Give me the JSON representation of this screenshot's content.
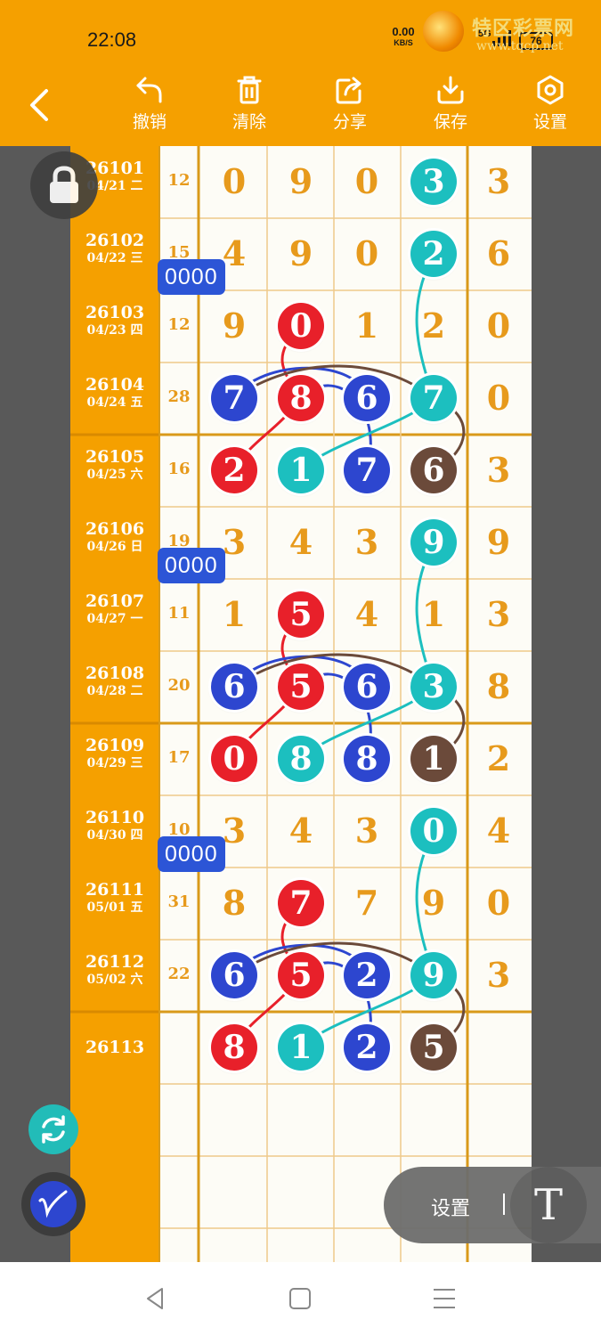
{
  "status_bar": {
    "time": "22:08",
    "net_speed": "0.00",
    "net_unit": "KB/S",
    "signal": "5G",
    "battery": "76"
  },
  "watermark": {
    "site_name": "特区彩票网",
    "url": "www.tqcp.net"
  },
  "toolbar": {
    "items": [
      {
        "label": "撤销",
        "icon": "undo-icon"
      },
      {
        "label": "清除",
        "icon": "trash-icon"
      },
      {
        "label": "分享",
        "icon": "share-icon"
      },
      {
        "label": "保存",
        "icon": "download-icon"
      },
      {
        "label": "设置",
        "icon": "gear-icon"
      }
    ]
  },
  "rows": [
    {
      "issue": "26101",
      "date": "04/21 二",
      "sum": "12",
      "digits": [
        "0",
        "9",
        "0",
        "3"
      ],
      "last": "3"
    },
    {
      "issue": "26102",
      "date": "04/22 三",
      "sum": "15",
      "digits": [
        "4",
        "9",
        "0",
        "2"
      ],
      "last": "6"
    },
    {
      "issue": "26103",
      "date": "04/23 四",
      "sum": "12",
      "digits": [
        "9",
        "0",
        "1",
        "2"
      ],
      "last": "0"
    },
    {
      "issue": "26104",
      "date": "04/24 五",
      "sum": "28",
      "digits": [
        "7",
        "8",
        "6",
        "7"
      ],
      "last": "0"
    },
    {
      "issue": "26105",
      "date": "04/25 六",
      "sum": "16",
      "digits": [
        "2",
        "1",
        "7",
        "6"
      ],
      "last": "3"
    },
    {
      "issue": "26106",
      "date": "04/26 日",
      "sum": "19",
      "digits": [
        "3",
        "4",
        "3",
        "9"
      ],
      "last": "9"
    },
    {
      "issue": "26107",
      "date": "04/27 一",
      "sum": "11",
      "digits": [
        "1",
        "5",
        "4",
        "1"
      ],
      "last": "3"
    },
    {
      "issue": "26108",
      "date": "04/28 二",
      "sum": "20",
      "digits": [
        "6",
        "5",
        "6",
        "3"
      ],
      "last": "8"
    },
    {
      "issue": "26109",
      "date": "04/29 三",
      "sum": "17",
      "digits": [
        "0",
        "8",
        "8",
        "1"
      ],
      "last": "2"
    },
    {
      "issue": "26110",
      "date": "04/30 四",
      "sum": "10",
      "digits": [
        "3",
        "4",
        "3",
        "0"
      ],
      "last": "4"
    },
    {
      "issue": "26111",
      "date": "05/01 五",
      "sum": "31",
      "digits": [
        "8",
        "7",
        "7",
        "9"
      ],
      "last": "0"
    },
    {
      "issue": "26112",
      "date": "05/02 六",
      "sum": "22",
      "digits": [
        "6",
        "5",
        "2",
        "9"
      ],
      "last": "3"
    },
    {
      "issue": "26113",
      "date": "",
      "sum": "",
      "digits": [
        "8",
        "1",
        "2",
        "5"
      ],
      "last": ""
    }
  ],
  "highlights": [
    {
      "row": 0,
      "col": 3,
      "color": "teal"
    },
    {
      "row": 1,
      "col": 3,
      "color": "teal"
    },
    {
      "row": 2,
      "col": 1,
      "color": "red"
    },
    {
      "row": 3,
      "col": 0,
      "color": "blue"
    },
    {
      "row": 3,
      "col": 1,
      "color": "red"
    },
    {
      "row": 3,
      "col": 2,
      "color": "blue"
    },
    {
      "row": 3,
      "col": 3,
      "color": "teal"
    },
    {
      "row": 4,
      "col": 0,
      "color": "red"
    },
    {
      "row": 4,
      "col": 1,
      "color": "teal"
    },
    {
      "row": 4,
      "col": 2,
      "color": "blue"
    },
    {
      "row": 4,
      "col": 3,
      "color": "brown"
    },
    {
      "row": 5,
      "col": 3,
      "color": "teal"
    },
    {
      "row": 6,
      "col": 1,
      "color": "red"
    },
    {
      "row": 7,
      "col": 0,
      "color": "blue"
    },
    {
      "row": 7,
      "col": 1,
      "color": "red"
    },
    {
      "row": 7,
      "col": 2,
      "color": "blue"
    },
    {
      "row": 7,
      "col": 3,
      "color": "teal"
    },
    {
      "row": 8,
      "col": 0,
      "color": "red"
    },
    {
      "row": 8,
      "col": 1,
      "color": "teal"
    },
    {
      "row": 8,
      "col": 2,
      "color": "blue"
    },
    {
      "row": 8,
      "col": 3,
      "color": "brown"
    },
    {
      "row": 9,
      "col": 3,
      "color": "teal"
    },
    {
      "row": 10,
      "col": 1,
      "color": "red"
    },
    {
      "row": 11,
      "col": 0,
      "color": "blue"
    },
    {
      "row": 11,
      "col": 1,
      "color": "red"
    },
    {
      "row": 11,
      "col": 2,
      "color": "blue"
    },
    {
      "row": 11,
      "col": 3,
      "color": "teal"
    },
    {
      "row": 12,
      "col": 0,
      "color": "red"
    },
    {
      "row": 12,
      "col": 1,
      "color": "teal"
    },
    {
      "row": 12,
      "col": 2,
      "color": "blue"
    },
    {
      "row": 12,
      "col": 3,
      "color": "brown"
    }
  ],
  "tags": [
    {
      "text": "0000",
      "near_row": 1
    },
    {
      "text": "0000",
      "near_row": 5
    },
    {
      "text": "0000",
      "near_row": 9
    }
  ],
  "colors": {
    "accent": "#f5a000",
    "red": "#e8202a",
    "blue": "#2d46cf",
    "teal": "#1cbfbf",
    "brown": "#6b4a3a",
    "digit": "#e79a1c"
  },
  "bottom_controls": {
    "settings_label": "设置",
    "text_tool_label": "T"
  },
  "nav": {
    "back": "back-icon",
    "home": "home-icon",
    "menu": "menu-icon"
  }
}
